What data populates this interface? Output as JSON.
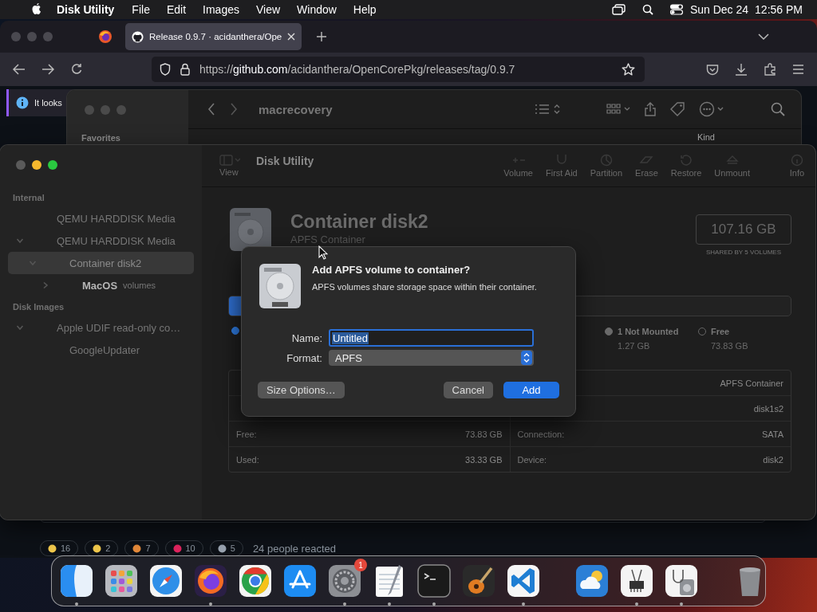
{
  "menubar": {
    "app_name": "Disk Utility",
    "menus": [
      "File",
      "Edit",
      "Images",
      "View",
      "Window",
      "Help"
    ],
    "date": "Sun Dec 24",
    "time": "12:56 PM"
  },
  "browser": {
    "tabs": [
      {
        "title": "Release 0.9.7 · acidanthera/Ope",
        "selected": true
      }
    ],
    "url": "https://**github.com**/acidanthera/OpenCorePkg/releases/tag/0.9.7",
    "notice": "It looks",
    "reactions": [
      {
        "kind": "thumbs-up",
        "count": "16"
      },
      {
        "kind": "laugh",
        "count": "2"
      },
      {
        "kind": "party",
        "count": "7"
      },
      {
        "kind": "heart",
        "count": "10"
      },
      {
        "kind": "rocket",
        "count": "5"
      }
    ],
    "reacted": "24 people reacted"
  },
  "finder": {
    "title": "macrecovery",
    "sidebar_heading": "Favorites",
    "column_heading": "Kind"
  },
  "disk_utility": {
    "title": "Disk Utility",
    "view_label": "View",
    "toolbar": [
      {
        "kind": "volume",
        "label": "Volume"
      },
      {
        "kind": "first-aid",
        "label": "First Aid"
      },
      {
        "kind": "partition",
        "label": "Partition"
      },
      {
        "kind": "erase",
        "label": "Erase"
      },
      {
        "kind": "restore",
        "label": "Restore"
      },
      {
        "kind": "unmount",
        "label": "Unmount"
      },
      {
        "kind": "info",
        "label": "Info"
      }
    ],
    "sidebar": [
      {
        "heading": "Internal",
        "items": [
          {
            "label": "QEMU HARDDISK Media",
            "selected": false
          },
          {
            "label": "QEMU HARDDISK Media",
            "expanded": true,
            "selected": false,
            "children": [
              {
                "label": "Container disk2",
                "expanded": true,
                "selected": true,
                "children": [
                  {
                    "label": "MacOS",
                    "note": "volumes",
                    "expanded": false,
                    "selected": false
                  }
                ]
              }
            ]
          }
        ]
      },
      {
        "heading": "Disk Images",
        "items": [
          {
            "label": "Apple UDIF read-only co…",
            "expanded": true,
            "selected": false,
            "children": [
              {
                "label": "GoogleUpdater",
                "selected": false
              }
            ]
          }
        ]
      }
    ],
    "header": {
      "name": "Container disk2",
      "type": "APFS Container",
      "capacity": "107.16 GB",
      "shared": "SHARED BY 5 VOLUMES"
    },
    "usage": {
      "level": 0.31
    },
    "legend": [
      {
        "kind": "used"
      },
      {
        "kind": "not-mounted",
        "label": "1 Not Mounted",
        "value": "1.27 GB"
      },
      {
        "kind": "free",
        "label": "Free",
        "value": "73.83 GB"
      }
    ],
    "info_rows": [
      {
        "right_value": "APFS Container"
      },
      {
        "right_value": "disk1s2"
      },
      {
        "left_label": "Free:",
        "left_value": "73.83 GB",
        "right_label": "Connection:",
        "right_value": "SATA"
      },
      {
        "left_label": "Used:",
        "left_value": "33.33 GB",
        "right_label": "Device:",
        "right_value": "disk2"
      }
    ]
  },
  "dialog": {
    "title": "Add APFS volume to container?",
    "message": "APFS volumes share storage space within their container.",
    "name_label": "Name:",
    "name_value": "Untitled",
    "format_label": "Format:",
    "format_value": "APFS",
    "buttons": [
      {
        "kind": "secondary",
        "label": "Size Options…"
      },
      {
        "kind": "secondary",
        "label": "Cancel"
      },
      {
        "kind": "default",
        "label": "Add"
      }
    ]
  },
  "dock": {
    "groups": [
      [
        {
          "kind": "finder",
          "running": true
        },
        {
          "kind": "launchpad",
          "running": false
        },
        {
          "kind": "safari",
          "running": false
        },
        {
          "kind": "firefox",
          "running": true
        },
        {
          "kind": "chrome",
          "running": false
        },
        {
          "kind": "appstore",
          "running": false
        },
        {
          "kind": "settings",
          "running": true,
          "badge": "1"
        },
        {
          "kind": "textedit",
          "running": true
        },
        {
          "kind": "terminal",
          "running": true
        },
        {
          "kind": "garageband",
          "running": false
        },
        {
          "kind": "vscode",
          "running": true
        }
      ],
      [
        {
          "kind": "weather",
          "running": false
        },
        {
          "kind": "sysinfo",
          "running": true
        },
        {
          "kind": "diskutility",
          "running": true
        }
      ],
      [
        {
          "kind": "trash",
          "running": false
        }
      ]
    ]
  }
}
